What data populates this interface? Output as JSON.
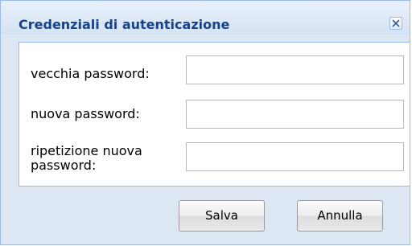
{
  "dialog": {
    "title": "Credenziali di autenticazione"
  },
  "form": {
    "old_password_label": "vecchia password:",
    "old_password_value": "",
    "new_password_label": "nuova password:",
    "new_password_value": "",
    "repeat_password_label": "ripetizione nuova password:",
    "repeat_password_value": ""
  },
  "buttons": {
    "save_label": "Salva",
    "cancel_label": "Annulla"
  },
  "icons": {
    "close": "close-icon"
  },
  "colors": {
    "title_text": "#15428b",
    "panel_background": "#dde7f3",
    "border": "#99bbe8"
  }
}
